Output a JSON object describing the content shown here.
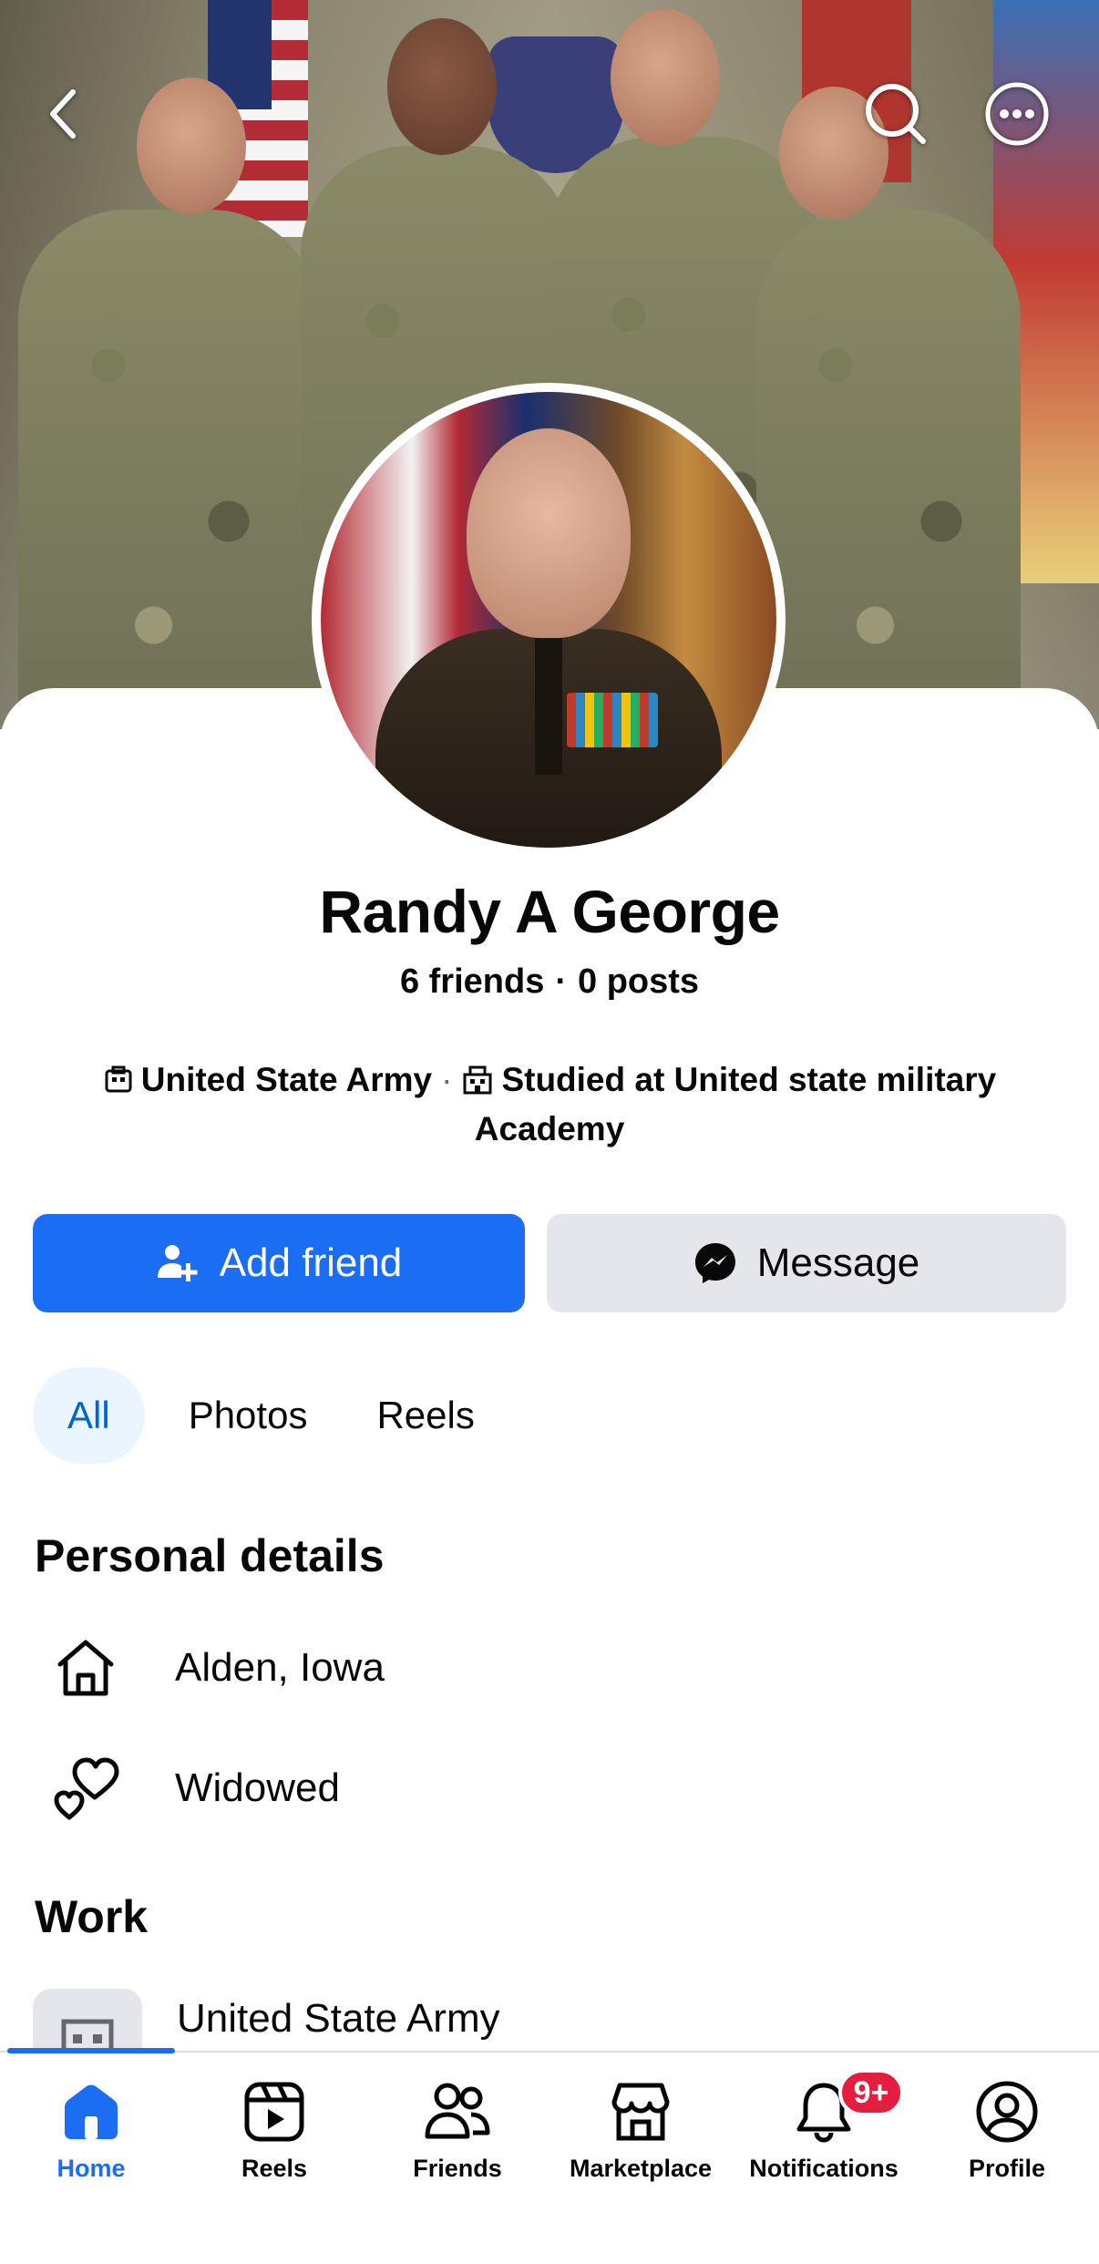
{
  "header": {
    "back_icon": "chevron-left-icon",
    "search_icon": "search-icon",
    "more_icon": "more-horizontal-icon"
  },
  "profile": {
    "name": "Randy A George",
    "friends": "6 friends",
    "separator": "·",
    "posts": "0 posts",
    "intro_work": "United State Army",
    "intro_sep": "·",
    "intro_school": "Studied at United  state military Academy"
  },
  "actions": {
    "add_friend": "Add friend",
    "message": "Message"
  },
  "tabs": [
    {
      "label": "All",
      "active": true
    },
    {
      "label": "Photos",
      "active": false
    },
    {
      "label": "Reels",
      "active": false
    }
  ],
  "personal_details": {
    "title": "Personal details",
    "items": [
      {
        "icon": "home-icon",
        "text": "Alden, Iowa"
      },
      {
        "icon": "hearts-icon",
        "text": "Widowed"
      }
    ]
  },
  "work": {
    "title": "Work",
    "items": [
      {
        "icon": "building-icon",
        "text": "United State Army"
      }
    ]
  },
  "nav": {
    "items": [
      {
        "label": "Home",
        "icon": "home-icon",
        "active": true
      },
      {
        "label": "Reels",
        "icon": "reels-icon",
        "active": false
      },
      {
        "label": "Friends",
        "icon": "friends-icon",
        "active": false
      },
      {
        "label": "Marketplace",
        "icon": "marketplace-icon",
        "active": false
      },
      {
        "label": "Notifications",
        "icon": "bell-icon",
        "active": false,
        "badge": "9+"
      },
      {
        "label": "Profile",
        "icon": "profile-icon",
        "active": false
      }
    ]
  },
  "colors": {
    "primary": "#1b6ef3",
    "secondary_button": "#e4e6eb",
    "active_tab_bg": "#ebf5ff",
    "badge": "#e41e3f"
  }
}
